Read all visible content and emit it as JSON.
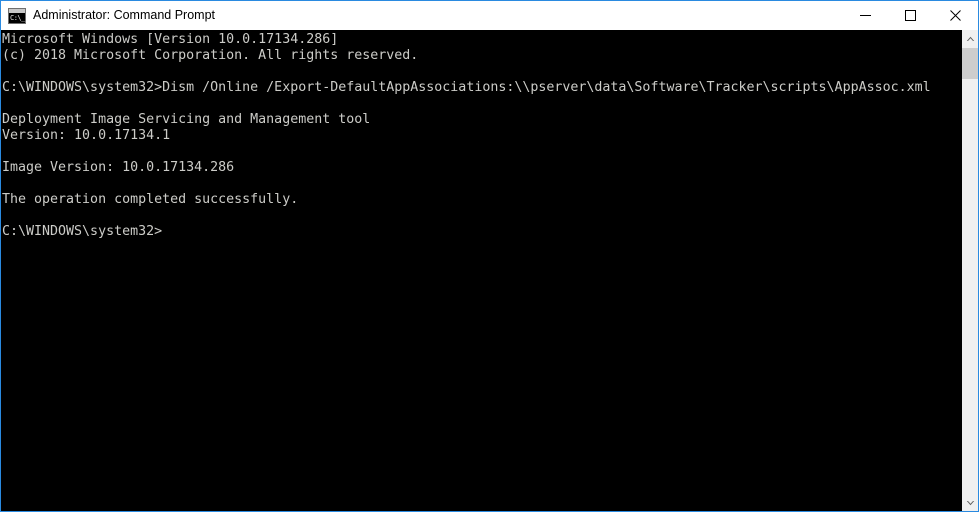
{
  "window": {
    "title": "Administrator: Command Prompt",
    "icon": "command-prompt-icon",
    "icon_glyph": "C:\\_",
    "border_color": "#2a8ae0",
    "titlebar_bg": "#ffffff",
    "console_bg": "#000000",
    "console_fg": "#ccccc8"
  },
  "controls": {
    "minimize_label": "Minimize",
    "maximize_label": "Maximize",
    "close_label": "Close"
  },
  "console": {
    "lines": [
      "Microsoft Windows [Version 10.0.17134.286]",
      "(c) 2018 Microsoft Corporation. All rights reserved.",
      "",
      "C:\\WINDOWS\\system32>Dism /Online /Export-DefaultAppAssociations:\\\\pserver\\data\\Software\\Tracker\\scripts\\AppAssoc.xml",
      "",
      "Deployment Image Servicing and Management tool",
      "Version: 10.0.17134.1",
      "",
      "Image Version: 10.0.17134.286",
      "",
      "The operation completed successfully.",
      "",
      "C:\\WINDOWS\\system32>"
    ],
    "text": "Microsoft Windows [Version 10.0.17134.286]\n(c) 2018 Microsoft Corporation. All rights reserved.\n\nC:\\WINDOWS\\system32>Dism /Online /Export-DefaultAppAssociations:\\\\pserver\\data\\Software\\Tracker\\scripts\\AppAssoc.xml\n\nDeployment Image Servicing and Management tool\nVersion: 10.0.17134.1\n\nImage Version: 10.0.17134.286\n\nThe operation completed successfully.\n\nC:\\WINDOWS\\system32>",
    "command": "Dism /Online /Export-DefaultAppAssociations:\\\\pserver\\data\\Software\\Tracker\\scripts\\AppAssoc.xml",
    "prompt": "C:\\WINDOWS\\system32>",
    "status": "The operation completed successfully.",
    "tool_name": "Deployment Image Servicing and Management tool",
    "tool_version": "Version: 10.0.17134.1",
    "image_version": "Image Version: 10.0.17134.286",
    "os_banner": "Microsoft Windows [Version 10.0.17134.286]",
    "copyright": "(c) 2018 Microsoft Corporation. All rights reserved."
  },
  "scrollbar": {
    "up_arrow": "scroll-up-arrow",
    "down_arrow": "scroll-down-arrow",
    "thumb": "scroll-thumb"
  }
}
